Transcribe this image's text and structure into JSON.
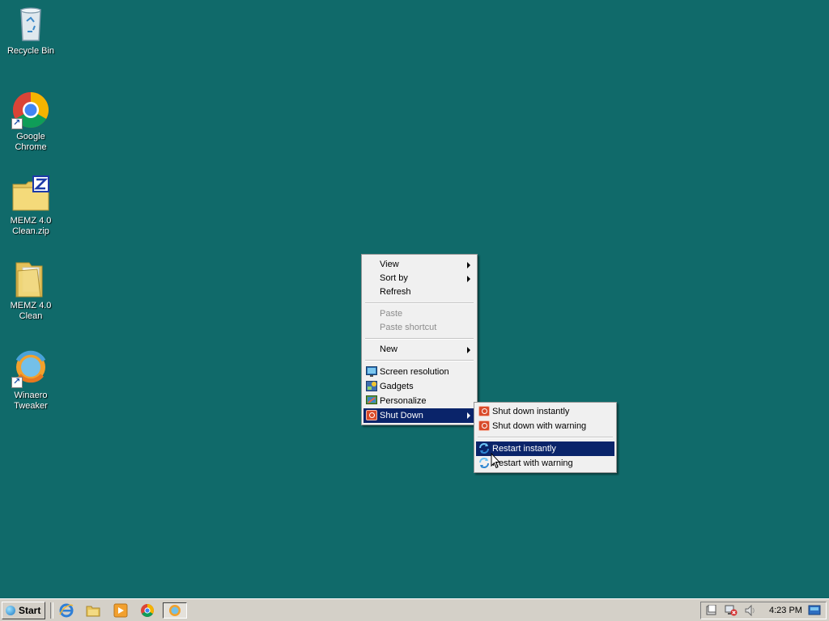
{
  "desktop": {
    "icons": [
      {
        "label": "Recycle Bin",
        "icon": "recycle-bin-icon"
      },
      {
        "label": "Google Chrome",
        "icon": "chrome-icon"
      },
      {
        "label": "MEMZ 4.0\nClean.zip",
        "icon": "zip-folder-icon"
      },
      {
        "label": "MEMZ 4.0\nClean",
        "icon": "folder-icon"
      },
      {
        "label": "Winaero\nTweaker",
        "icon": "winaero-tweaker-icon"
      }
    ]
  },
  "context_menu": {
    "items": {
      "view": "View",
      "sort_by": "Sort by",
      "refresh": "Refresh",
      "paste": "Paste",
      "paste_shortcut": "Paste shortcut",
      "new": "New",
      "screen_resolution": "Screen resolution",
      "gadgets": "Gadgets",
      "personalize": "Personalize",
      "shut_down": "Shut Down"
    }
  },
  "submenu": {
    "items": {
      "shut_down_instantly": "Shut down instantly",
      "shut_down_with_warning": "Shut down with warning",
      "restart_instantly": "Restart instantly",
      "restart_with_warning": "Restart with warning"
    },
    "selected": "Restart instantly"
  },
  "taskbar": {
    "start_label": "Start",
    "clock": "4:23 PM",
    "quick_launch": [
      "internet-explorer-icon",
      "file-explorer-icon",
      "media-player-icon",
      "chrome-icon",
      "winaero-tweaker-icon"
    ]
  },
  "colors": {
    "desktop": "#106a6a",
    "selection": "#0a246a",
    "menu_bg": "#f0f0f0"
  }
}
